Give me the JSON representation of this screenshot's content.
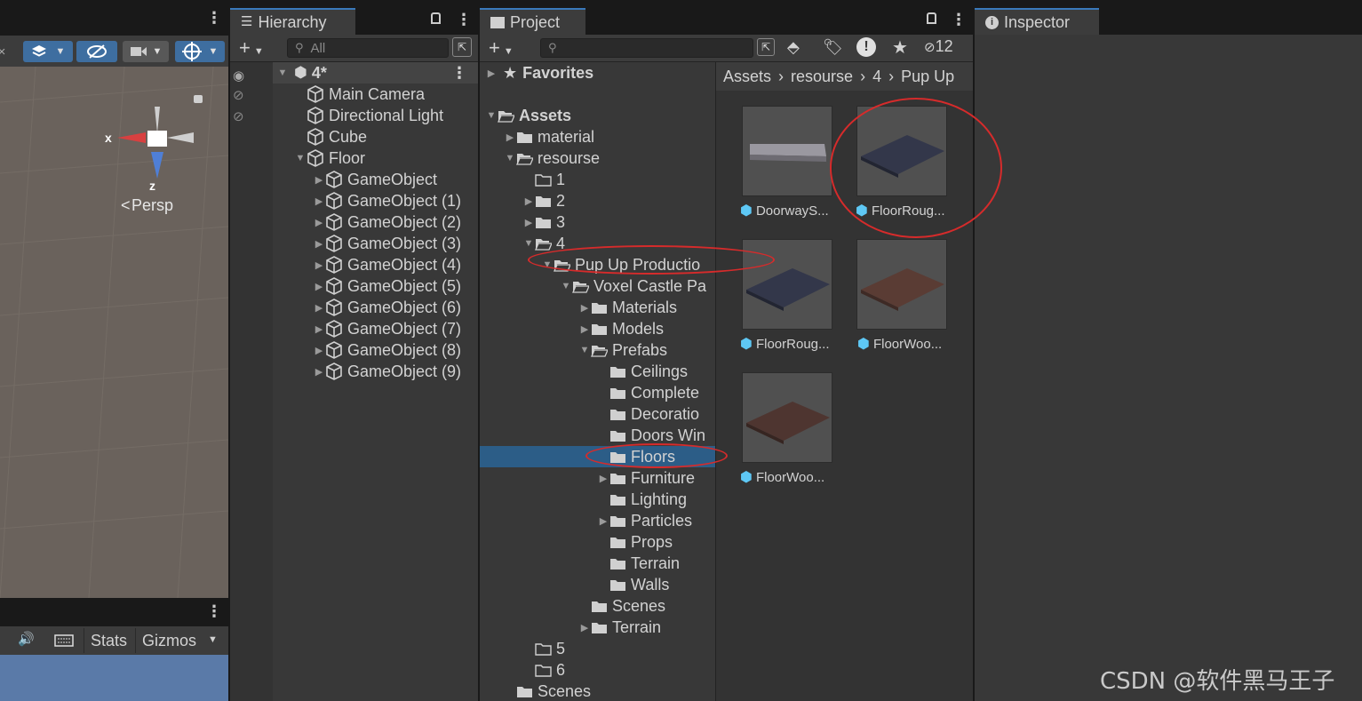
{
  "scene": {
    "persp_label": "Persp",
    "x_axis": "x",
    "z_axis": "z",
    "bottom_toolbar": {
      "stats": "Stats",
      "gizmos": "Gizmos"
    }
  },
  "hierarchy": {
    "tab_title": "Hierarchy",
    "search_placeholder": "All",
    "scene_name": "4*",
    "items": [
      {
        "label": "Main Camera"
      },
      {
        "label": "Directional Light"
      },
      {
        "label": "Cube"
      },
      {
        "label": "Floor"
      },
      {
        "label": "GameObject"
      },
      {
        "label": "GameObject (1)"
      },
      {
        "label": "GameObject (2)"
      },
      {
        "label": "GameObject (3)"
      },
      {
        "label": "GameObject (4)"
      },
      {
        "label": "GameObject (5)"
      },
      {
        "label": "GameObject (6)"
      },
      {
        "label": "GameObject (7)"
      },
      {
        "label": "GameObject (8)"
      },
      {
        "label": "GameObject (9)"
      }
    ]
  },
  "project": {
    "tab_title": "Project",
    "hidden_count": "12",
    "favorites": "Favorites",
    "tree": [
      {
        "label": "Assets"
      },
      {
        "label": "material"
      },
      {
        "label": "resourse"
      },
      {
        "label": "1"
      },
      {
        "label": "2"
      },
      {
        "label": "3"
      },
      {
        "label": "4"
      },
      {
        "label": "Pup Up Productio"
      },
      {
        "label": "Voxel Castle Pa"
      },
      {
        "label": "Materials"
      },
      {
        "label": "Models"
      },
      {
        "label": "Prefabs"
      },
      {
        "label": "Ceilings"
      },
      {
        "label": "Complete"
      },
      {
        "label": "Decoratio"
      },
      {
        "label": "Doors Win"
      },
      {
        "label": "Floors"
      },
      {
        "label": "Furniture"
      },
      {
        "label": "Lighting"
      },
      {
        "label": "Particles"
      },
      {
        "label": "Props"
      },
      {
        "label": "Terrain"
      },
      {
        "label": "Walls"
      },
      {
        "label": "Scenes"
      },
      {
        "label": "Terrain"
      },
      {
        "label": "5"
      },
      {
        "label": "6"
      },
      {
        "label": "Scenes"
      }
    ],
    "breadcrumb": [
      "Assets",
      "resourse",
      "4",
      "Pup Up"
    ],
    "assets": [
      {
        "label": "DoorwayS..."
      },
      {
        "label": "FloorRoug..."
      },
      {
        "label": "FloorRoug..."
      },
      {
        "label": "FloorWoo..."
      },
      {
        "label": "FloorWoo..."
      }
    ]
  },
  "inspector": {
    "tab_title": "Inspector"
  },
  "watermark": "CSDN @软件黑马王子",
  "colors": {
    "annotation": "#d62b2b",
    "selection": "#2c5d87",
    "panel": "#383838"
  }
}
